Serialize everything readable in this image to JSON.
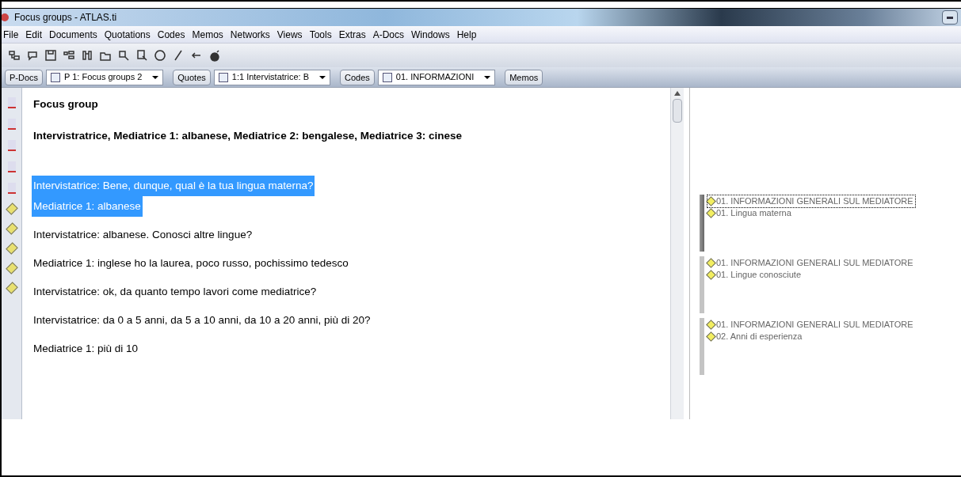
{
  "window": {
    "title": "Focus groups - ATLAS.ti"
  },
  "menu": [
    "File",
    "Edit",
    "Documents",
    "Quotations",
    "Codes",
    "Memos",
    "Networks",
    "Views",
    "Tools",
    "Extras",
    "A-Docs",
    "Windows",
    "Help"
  ],
  "navigator": [
    {
      "kind": "button",
      "label": "P-Docs"
    },
    {
      "kind": "dropdown",
      "label": "P 1: Focus groups 2"
    },
    {
      "kind": "button",
      "label": "Quotes"
    },
    {
      "kind": "dropdown",
      "label": "1:1 Intervistatrice: B"
    },
    {
      "kind": "button",
      "label": "Codes"
    },
    {
      "kind": "dropdown",
      "label": "01. INFORMAZIONI"
    },
    {
      "kind": "button",
      "label": "Memos"
    }
  ],
  "document": {
    "lines": [
      {
        "text": "Focus group",
        "bold": true,
        "selected": false
      },
      {
        "text": "Intervistratrice, Mediatrice 1: albanese, Mediatrice 2: bengalese, Mediatrice 3: cinese",
        "bold": true,
        "selected": false
      },
      {
        "text": "Intervistatrice: Bene, dunque, qual è la tua lingua materna?",
        "bold": false,
        "selected": true
      },
      {
        "text": "Mediatrice 1: albanese",
        "bold": false,
        "selected": true
      },
      {
        "text": "Intervistatrice: albanese. Conosci altre lingue?",
        "bold": false,
        "selected": false
      },
      {
        "text": "Mediatrice 1: inglese ho la laurea, poco russo, pochissimo tedesco",
        "bold": false,
        "selected": false
      },
      {
        "text": "Intervistatrice: ok, da quanto tempo lavori come mediatrice?",
        "bold": false,
        "selected": false
      },
      {
        "text": "Intervistatrice: da 0 a 5 anni, da 5 a 10 anni, da 10 a 20 anni, più di 20?",
        "bold": false,
        "selected": false
      },
      {
        "text": "Mediatrice 1: più di 10",
        "bold": false,
        "selected": false
      }
    ]
  },
  "margin": [
    {
      "selected": true,
      "codes": [
        "01. INFORMAZIONI GENERALI SUL MEDIATORE",
        "01. Lingua materna"
      ]
    },
    {
      "selected": false,
      "codes": [
        "01. INFORMAZIONI GENERALI SUL MEDIATORE",
        "01. Lingue conosciute"
      ]
    },
    {
      "selected": false,
      "codes": [
        "01. INFORMAZIONI GENERALI SUL MEDIATORE",
        "02. Anni di esperienza"
      ]
    }
  ]
}
